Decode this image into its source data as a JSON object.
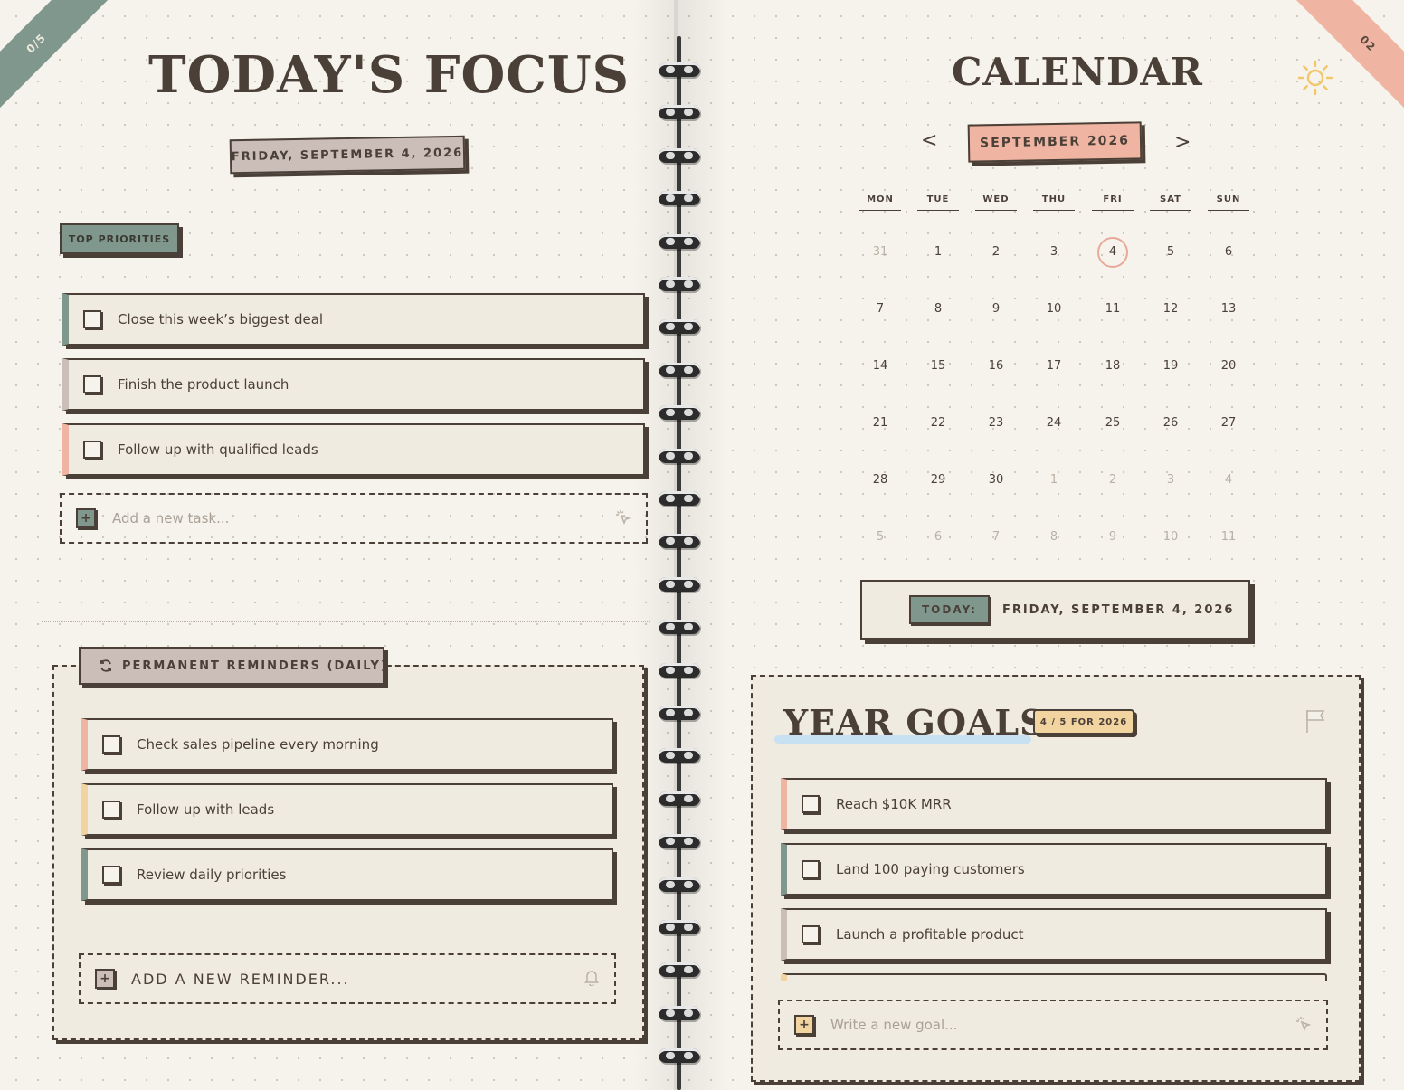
{
  "left_page": {
    "corner_label": "0/5",
    "title": "TODAY'S FOCUS",
    "date_label": "FRIDAY, SEPTEMBER 4, 2026",
    "priorities_tag": "TOP PRIORITIES",
    "priorities": [
      {
        "label": "Close this week’s biggest deal",
        "accent": "#7f978d"
      },
      {
        "label": "Finish the product launch",
        "accent": "#cbbdb8"
      },
      {
        "label": "Follow up with qualified leads",
        "accent": "#f0b5a2"
      }
    ],
    "add_task_placeholder": "Add a new task...",
    "add_task_icon": "sparkle-cursor-icon",
    "reminders": {
      "header": "PERMANENT REMINDERS (DAILY)",
      "header_icon": "refresh-icon",
      "items": [
        {
          "label": "Check sales pipeline every morning",
          "accent": "#f0b5a2"
        },
        {
          "label": "Follow up with leads",
          "accent": "#f2d4a0"
        },
        {
          "label": "Review daily priorities",
          "accent": "#7f978d"
        }
      ],
      "add_placeholder": "ADD A NEW REMINDER...",
      "add_icon": "bell-icon"
    }
  },
  "right_page": {
    "corner_label": "02",
    "title": "CALENDAR",
    "theme_icon": "sun-icon",
    "calendar": {
      "prev": "<",
      "next": ">",
      "month_label": "SEPTEMBER 2026",
      "weekdays": [
        "MON",
        "TUE",
        "WED",
        "THU",
        "FRI",
        "SAT",
        "SUN"
      ],
      "weeks": [
        [
          {
            "d": "31",
            "m": true
          },
          {
            "d": "1"
          },
          {
            "d": "2"
          },
          {
            "d": "3"
          },
          {
            "d": "4",
            "today": true
          },
          {
            "d": "5"
          },
          {
            "d": "6"
          }
        ],
        [
          {
            "d": "7"
          },
          {
            "d": "8"
          },
          {
            "d": "9"
          },
          {
            "d": "10"
          },
          {
            "d": "11"
          },
          {
            "d": "12"
          },
          {
            "d": "13"
          }
        ],
        [
          {
            "d": "14"
          },
          {
            "d": "15"
          },
          {
            "d": "16"
          },
          {
            "d": "17"
          },
          {
            "d": "18"
          },
          {
            "d": "19"
          },
          {
            "d": "20"
          }
        ],
        [
          {
            "d": "21"
          },
          {
            "d": "22"
          },
          {
            "d": "23"
          },
          {
            "d": "24"
          },
          {
            "d": "25"
          },
          {
            "d": "26"
          },
          {
            "d": "27"
          }
        ],
        [
          {
            "d": "28"
          },
          {
            "d": "29"
          },
          {
            "d": "30"
          },
          {
            "d": "1",
            "m": true
          },
          {
            "d": "2",
            "m": true
          },
          {
            "d": "3",
            "m": true
          },
          {
            "d": "4",
            "m": true
          }
        ],
        [
          {
            "d": "5",
            "m": true
          },
          {
            "d": "6",
            "m": true
          },
          {
            "d": "7",
            "m": true
          },
          {
            "d": "8",
            "m": true
          },
          {
            "d": "9",
            "m": true
          },
          {
            "d": "10",
            "m": true
          },
          {
            "d": "11",
            "m": true
          }
        ]
      ]
    },
    "today_bar": {
      "tag": "TODAY:",
      "date": "FRIDAY, SEPTEMBER 4, 2026"
    },
    "goals": {
      "title": "YEAR GOALS",
      "badge": "4 / 5 FOR 2026",
      "flag_icon": "flag-icon",
      "items": [
        {
          "label": "Reach $10K MRR",
          "accent": "#f0b5a2"
        },
        {
          "label": "Land 100 paying customers",
          "accent": "#7f978d"
        },
        {
          "label": "Launch a profitable product",
          "accent": "#cbbdb8"
        }
      ],
      "add_placeholder": "Write a new goal...",
      "add_icon": "sparkle-cursor-icon"
    }
  },
  "colors": {
    "ink": "#4a4038",
    "paper": "#f6f3ec",
    "sage": "#7f978d",
    "peach": "#f0b5a2",
    "mauve": "#cbbdb8",
    "sand": "#f2d4a0",
    "sky": "#c7e0f2"
  }
}
